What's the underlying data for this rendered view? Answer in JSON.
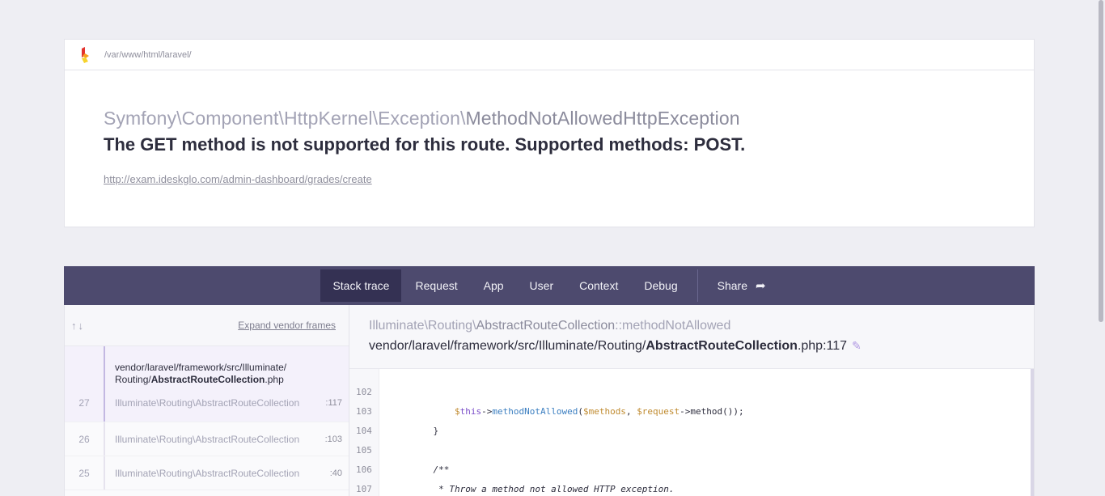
{
  "header": {
    "path": "/var/www/html/laravel/",
    "exception_namespace": "Symfony\\Component\\HttpKernel\\Exception\\",
    "exception_short": "MethodNotAllowedHttpException",
    "message": "The GET method is not supported for this route. Supported methods: POST.",
    "url": "http://exam.ideskglo.com/admin-dashboard/grades/create"
  },
  "tabs": [
    {
      "label": "Stack trace",
      "active": true
    },
    {
      "label": "Request"
    },
    {
      "label": "App"
    },
    {
      "label": "User"
    },
    {
      "label": "Context"
    },
    {
      "label": "Debug"
    },
    {
      "label": "Share"
    }
  ],
  "frames_panel": {
    "arrows": "↑↓",
    "expand_label": "Expand vendor frames",
    "active_frame": {
      "file_line1": "vendor/laravel/framework/src/Illuminate/",
      "file_line2_prefix": "Routing/",
      "file_line2_bold": "AbstractRouteCollection",
      "file_line2_ext": ".php",
      "number": "27",
      "class": "Illuminate\\Routing\\AbstractRouteCollection",
      "line": ":117"
    },
    "frames": [
      {
        "number": "26",
        "class": "Illuminate\\Routing\\AbstractRouteCollection",
        "line": ":103"
      },
      {
        "number": "25",
        "class": "Illuminate\\Routing\\AbstractRouteCollection",
        "line": ":40"
      }
    ]
  },
  "code": {
    "method_ns": "Illuminate\\Routing\\",
    "method_class": "AbstractRouteCollection",
    "method_sep": "::",
    "method_name": "methodNotAllowed",
    "file_prefix": "vendor/laravel/framework/src/Illuminate/Routing/",
    "file_bold": "AbstractRouteCollection",
    "file_suffix": ".php:117",
    "line_numbers": [
      "102",
      "103",
      "104",
      "105",
      "106",
      "107"
    ]
  },
  "colors": {
    "tab_bar": "#4d4a6e",
    "tab_active": "#343153",
    "accent": "#b199e3"
  }
}
